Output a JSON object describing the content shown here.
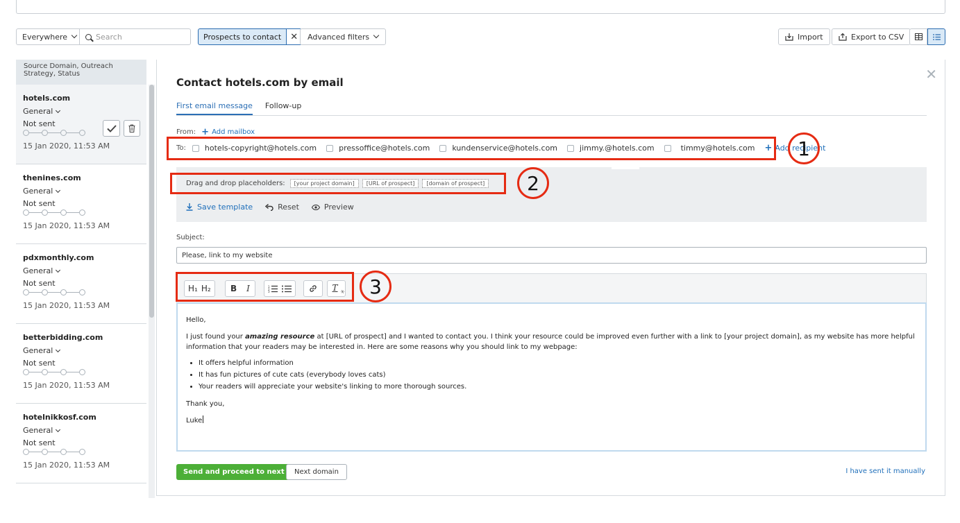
{
  "toolbar": {
    "scope_select": "Everywhere",
    "search_placeholder": "Search",
    "filter_tag": "Prospects to contact",
    "advanced_filters": "Advanced filters",
    "import": "Import",
    "export": "Export to CSV"
  },
  "list": {
    "header": "Source Domain, Outreach Strategy, Status",
    "items": [
      {
        "domain": "hotels.com",
        "strategy": "General",
        "status": "Not sent",
        "date": "15 Jan 2020, 11:53 AM"
      },
      {
        "domain": "thenines.com",
        "strategy": "General",
        "status": "Not sent",
        "date": "15 Jan 2020, 11:53 AM"
      },
      {
        "domain": "pdxmonthly.com",
        "strategy": "General",
        "status": "Not sent",
        "date": "15 Jan 2020, 11:53 AM"
      },
      {
        "domain": "betterbidding.com",
        "strategy": "General",
        "status": "Not sent",
        "date": "15 Jan 2020, 11:53 AM"
      },
      {
        "domain": "hotelnikkosf.com",
        "strategy": "General",
        "status": "Not sent",
        "date": "15 Jan 2020, 11:53 AM"
      }
    ]
  },
  "panel": {
    "title": "Contact hotels.com by email",
    "tabs": [
      "First email message",
      "Follow-up"
    ],
    "from_label": "From:",
    "add_mailbox": "Add mailbox",
    "to_label": "To:",
    "recipients": [
      "hotels-copyright@hotels.com",
      "pressoffice@hotels.com",
      "kundenservice@hotels.com",
      "jimmy.@hotels.com",
      "timmy@hotels.com"
    ],
    "add_recipient": "Add recipient",
    "placeholders_label": "Drag and drop placeholders:",
    "placeholders": [
      "[your project domain]",
      "[URL of prospect]",
      "[domain of prospect]"
    ],
    "save_template": "Save template",
    "reset": "Reset",
    "preview": "Preview",
    "subject_label": "Subject:",
    "subject_value": "Please, link to my website",
    "format_buttons": {
      "h1": "H₁",
      "h2": "H₂",
      "bold": "B",
      "italic": "I",
      "clear": "T"
    },
    "body": {
      "greeting": "Hello,",
      "p1_a": "I just found your ",
      "p1_em": "amazing resource",
      "p1_b": " at [URL of prospect] and I wanted to contact you. I think your resource could be improved even further with a link to [your project domain], as my website has more helpful information that your readers may be interested in. Here are some reasons why you should link to my webpage:",
      "bullets": [
        "It offers helpful information",
        "It has fun pictures of cute cats (everybody loves cats)",
        "Your readers will appreciate your website's linking to more thorough sources."
      ],
      "thanks": "Thank you,",
      "signature": "Luke"
    },
    "send_button": "Send and proceed to next",
    "next_button": "Next domain",
    "manual_link": "I have sent it manually"
  },
  "annotations": [
    "1",
    "2",
    "3"
  ],
  "colors": {
    "annotation": "#e52b13",
    "primary": "#4caf37",
    "link": "#1f6fba"
  }
}
